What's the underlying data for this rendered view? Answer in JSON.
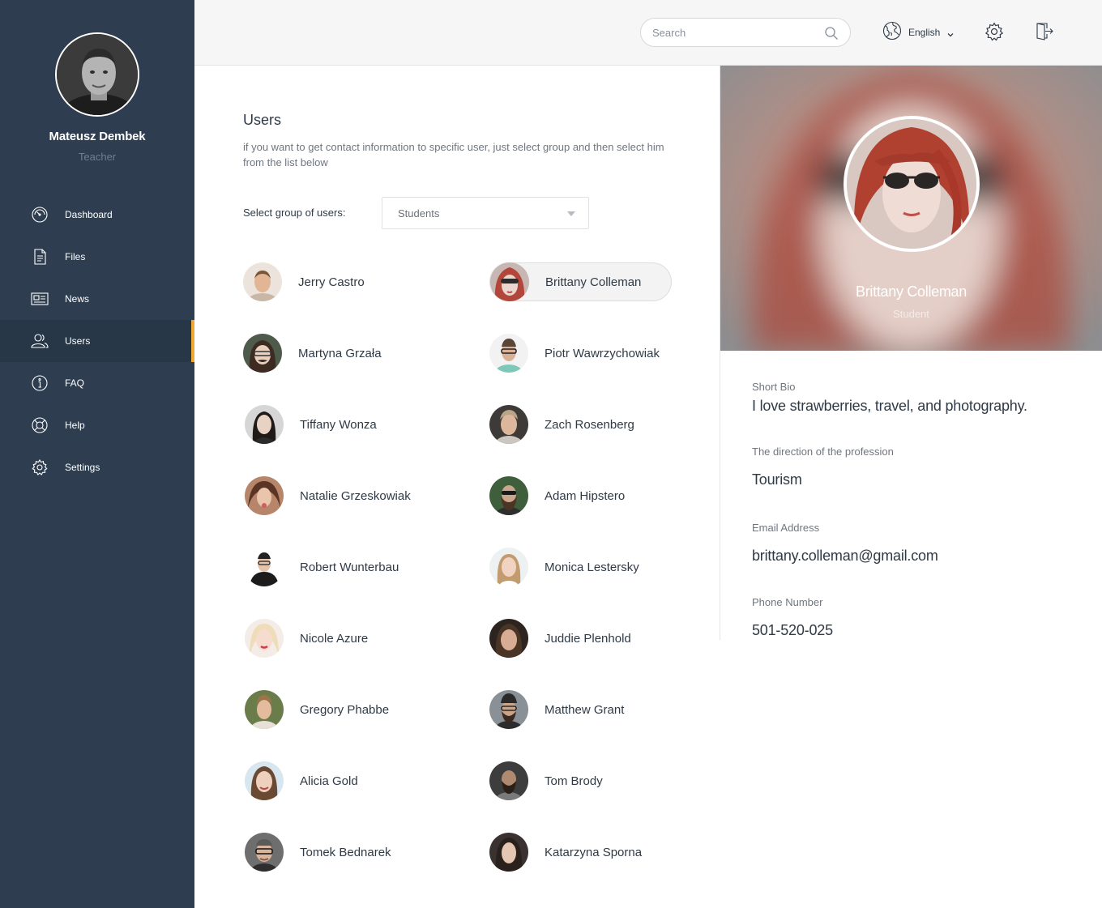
{
  "sidebar": {
    "profile": {
      "name": "Mateusz Dembek",
      "role": "Teacher"
    },
    "items": [
      {
        "label": "Dashboard",
        "icon": "dashboard-icon",
        "active": false
      },
      {
        "label": "Files",
        "icon": "file-icon",
        "active": false
      },
      {
        "label": "News",
        "icon": "news-icon",
        "active": false
      },
      {
        "label": "Users",
        "icon": "users-icon",
        "active": true
      },
      {
        "label": "FAQ",
        "icon": "info-icon",
        "active": false
      },
      {
        "label": "Help",
        "icon": "lifebuoy-icon",
        "active": false
      },
      {
        "label": "Settings",
        "icon": "gear-icon",
        "active": false
      }
    ],
    "accent_color": "#f0a932",
    "background_color": "#2e3e50"
  },
  "topbar": {
    "search": {
      "placeholder": "Search",
      "value": ""
    },
    "language": "English"
  },
  "main": {
    "title": "Users",
    "description": "if you want to get contact information to specific user, just select group and then select him from the list below",
    "group_label": "Select group of users:",
    "group_value": "Students",
    "users": [
      {
        "name": "Jerry Castro",
        "selected": false
      },
      {
        "name": "Brittany Colleman",
        "selected": true
      },
      {
        "name": "Martyna Grzała",
        "selected": false
      },
      {
        "name": "Piotr Wawrzychowiak",
        "selected": false
      },
      {
        "name": "Tiffany Wonza",
        "selected": false
      },
      {
        "name": "Zach Rosenberg",
        "selected": false
      },
      {
        "name": "Natalie Grzeskowiak",
        "selected": false
      },
      {
        "name": "Adam Hipstero",
        "selected": false
      },
      {
        "name": "Robert Wunterbau",
        "selected": false
      },
      {
        "name": "Monica Lestersky",
        "selected": false
      },
      {
        "name": "Nicole Azure",
        "selected": false
      },
      {
        "name": "Juddie Plenhold",
        "selected": false
      },
      {
        "name": "Gregory Phabbe",
        "selected": false
      },
      {
        "name": "Matthew Grant",
        "selected": false
      },
      {
        "name": "Alicia Gold",
        "selected": false
      },
      {
        "name": "Tom Brody",
        "selected": false
      },
      {
        "name": "Tomek Bednarek",
        "selected": false
      },
      {
        "name": "Katarzyna Sporna",
        "selected": false
      }
    ]
  },
  "detail": {
    "name": "Brittany Colleman",
    "role": "Student",
    "fields": [
      {
        "label": "Short Bio",
        "value": "I love strawberries, travel, and photography."
      },
      {
        "label": "The direction of the profession",
        "value": "Tourism"
      },
      {
        "label": "Email Address",
        "value": "brittany.colleman@gmail.com"
      },
      {
        "label": "Phone Number",
        "value": "501-520-025"
      }
    ]
  }
}
